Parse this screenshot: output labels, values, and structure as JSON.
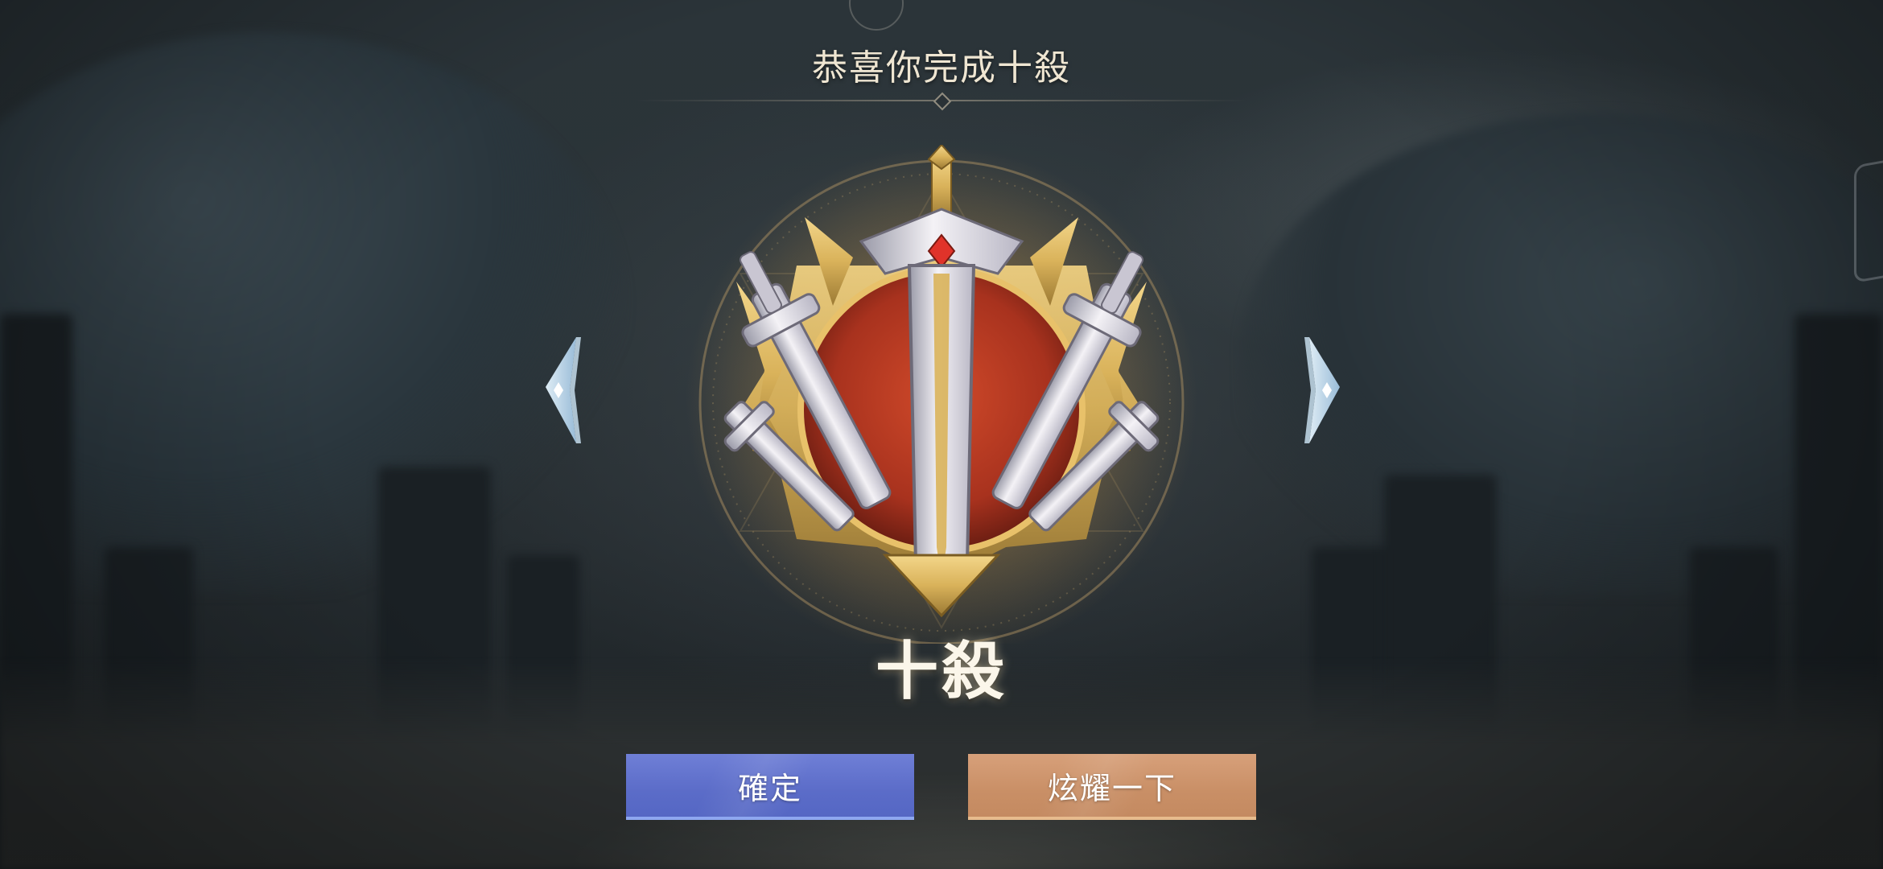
{
  "header": {
    "title": "恭喜你完成十殺"
  },
  "achievement": {
    "label": "十殺",
    "medal_icon": "ten-kill-medal-icon"
  },
  "navigation": {
    "prev_icon": "chevron-left-icon",
    "next_icon": "chevron-right-icon"
  },
  "buttons": {
    "confirm_label": "確定",
    "share_label": "炫耀一下"
  },
  "colors": {
    "confirm": "#5b6cc8",
    "share": "#c98f66",
    "title": "#efe6d2",
    "medal_gold": "#d9b25a",
    "medal_red": "#a8321e"
  }
}
